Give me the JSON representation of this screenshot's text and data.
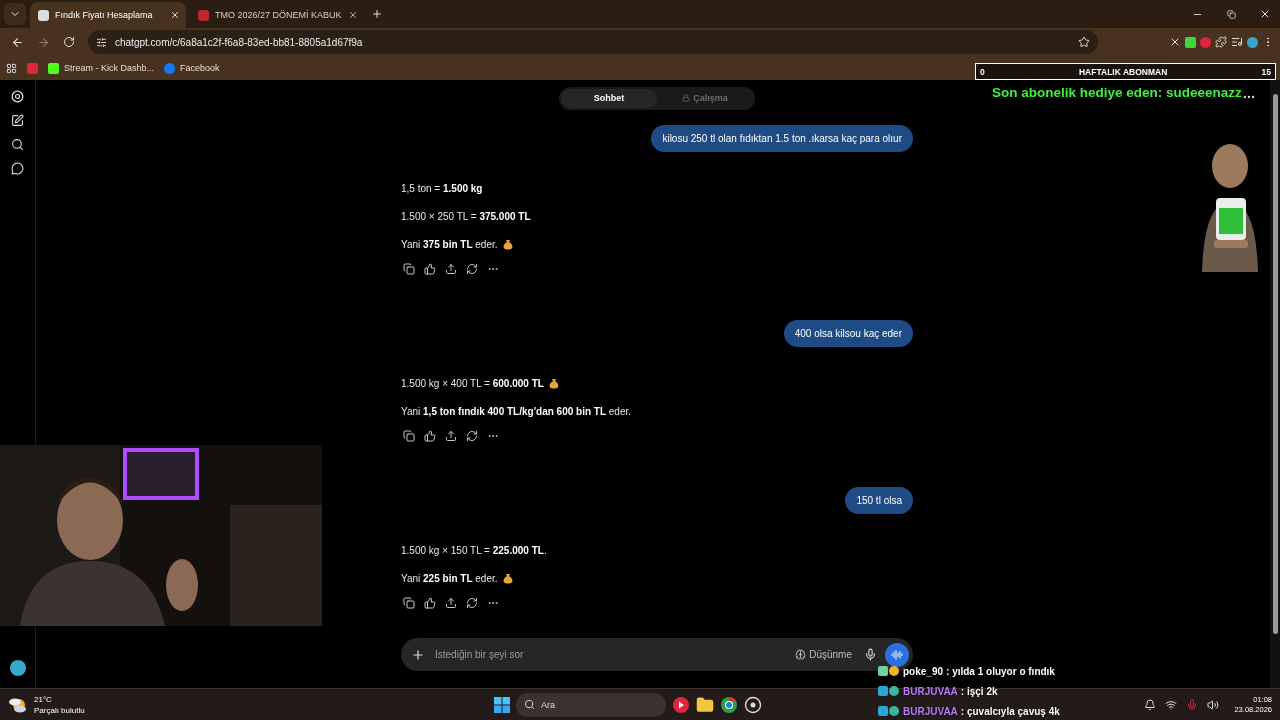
{
  "browser": {
    "tabs": [
      {
        "title": "Fındık Fiyatı Hesaplama",
        "selected": true
      },
      {
        "title": "TMO 2026/27 DÖNEMİ KABUK",
        "selected": false
      }
    ],
    "address": "chatgpt.com/c/6a8a1c2f-f6a8-83ed-bb81-8805a1d67f9a",
    "bookmarks": [
      {
        "label": "Stream - Kick Dashb...",
        "kind": "kick"
      },
      {
        "label": "Facebook",
        "kind": "facebook"
      }
    ]
  },
  "chat": {
    "modes": [
      {
        "label": "Sohbet",
        "selected": true
      },
      {
        "label": "Çalışma",
        "selected": false
      }
    ],
    "turns": [
      {
        "question": "kilosu 250 tl olan fıdıktan 1.5 ton .ıkarsa kaç para olıur",
        "answer": [
          {
            "text": "1,5 ton = **1.500 kg**",
            "money_bag": false
          },
          {
            "text": "1.500 × 250 TL = **375.000 TL**",
            "money_bag": false
          },
          {
            "text": "Yani **375 bin TL** eder.",
            "money_bag": true
          }
        ]
      },
      {
        "question": "400 olsa kilsou kaç eder",
        "answer": [
          {
            "text": "1.500 kg × 400 TL = **600.000 TL**",
            "money_bag": true
          },
          {
            "text": "Yani **1,5 ton fındık 400 TL/kg'dan 600 bin TL** eder.",
            "money_bag": false
          }
        ]
      },
      {
        "question": "150 tl olsa",
        "answer": [
          {
            "text": "1.500 kg × 150 TL = **225.000 TL**.",
            "money_bag": false
          },
          {
            "text": "Yani **225 bin TL** eder.",
            "money_bag": true
          }
        ]
      }
    ],
    "composer": {
      "placeholder": "İstediğin bir şeyi sor",
      "think_label": "Düşünme"
    }
  },
  "overlay": {
    "goal": {
      "start": "0",
      "title": "HAFTALIK ABONMAN",
      "end": "15"
    },
    "last_gift": "Son abonelik hediye eden: sudeeenazz",
    "chat": [
      {
        "user": "poke_90",
        "message": ": yılda 1 oluyor o fındık",
        "color": "#ffffff"
      },
      {
        "user": "BURJUVAA",
        "message": ": işçi 2k",
        "color": "#b67cff"
      },
      {
        "user": "BURJUVAA",
        "message": ": çuvalcıyla çavuş 4k",
        "color": "#b67cff"
      }
    ]
  },
  "taskbar": {
    "weather": {
      "temperature": "21°C",
      "condition": "Parçalı bulutlu"
    },
    "search": "Ara",
    "time": "01:08",
    "date": "23.08.2026"
  }
}
